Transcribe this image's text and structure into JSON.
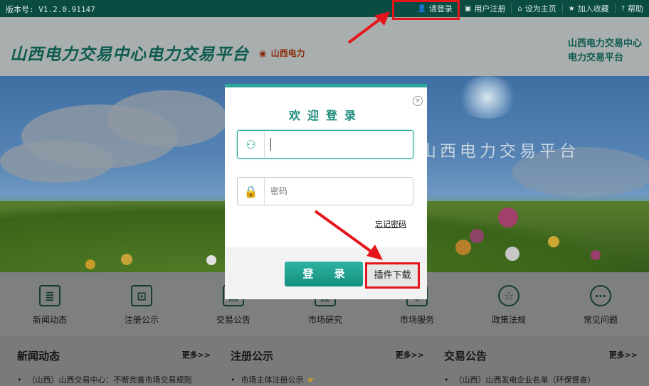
{
  "topbar": {
    "version": "版本号: V1.2.0.91147",
    "nav": [
      {
        "icon": "user-icon",
        "glyph": "👤",
        "label": "请登录"
      },
      {
        "icon": "register-icon",
        "glyph": "▣",
        "label": "用户注册"
      },
      {
        "icon": "home-icon",
        "glyph": "⌂",
        "label": "设为主页"
      },
      {
        "icon": "star-icon",
        "glyph": "★",
        "label": "加入收藏"
      },
      {
        "icon": "help-icon",
        "glyph": "?",
        "label": "帮助"
      }
    ]
  },
  "header": {
    "title": "山西电力交易中心电力交易平台",
    "region": "山西电力",
    "right_line1": "山西电力交易中心",
    "right_line2": "电力交易平台"
  },
  "banner": {
    "text": "山西电力交易平台"
  },
  "icons": [
    {
      "icon": "news-icon",
      "glyph": "≣",
      "label": "新闻动态"
    },
    {
      "icon": "register-notice-icon",
      "glyph": "⊡",
      "label": "注册公示"
    },
    {
      "icon": "trade-notice-icon",
      "glyph": "▤",
      "label": "交易公告"
    },
    {
      "icon": "research-icon",
      "glyph": "▥",
      "label": "市场研究"
    },
    {
      "icon": "service-icon",
      "glyph": "◈",
      "label": "市场服务"
    },
    {
      "icon": "policy-icon",
      "glyph": "☆",
      "label": "政策法规"
    },
    {
      "icon": "faq-icon",
      "glyph": "⋯",
      "label": "常见问题"
    }
  ],
  "news": [
    {
      "title": "新闻动态",
      "more": "更多>>",
      "item": "（山西）山西交易中心：不断完善市场交易规则"
    },
    {
      "title": "注册公示",
      "more": "更多>>",
      "item": "市场主体注册公示"
    },
    {
      "title": "交易公告",
      "more": "更多>>",
      "item": "（山西）山西发电企业名单（环保督查）"
    }
  ],
  "login": {
    "title": "欢迎登录",
    "username_value": "",
    "password_placeholder": "密码",
    "forgot": "忘记密码",
    "login_button": "登 录",
    "plugin_button": "插件下载",
    "close": "×"
  }
}
